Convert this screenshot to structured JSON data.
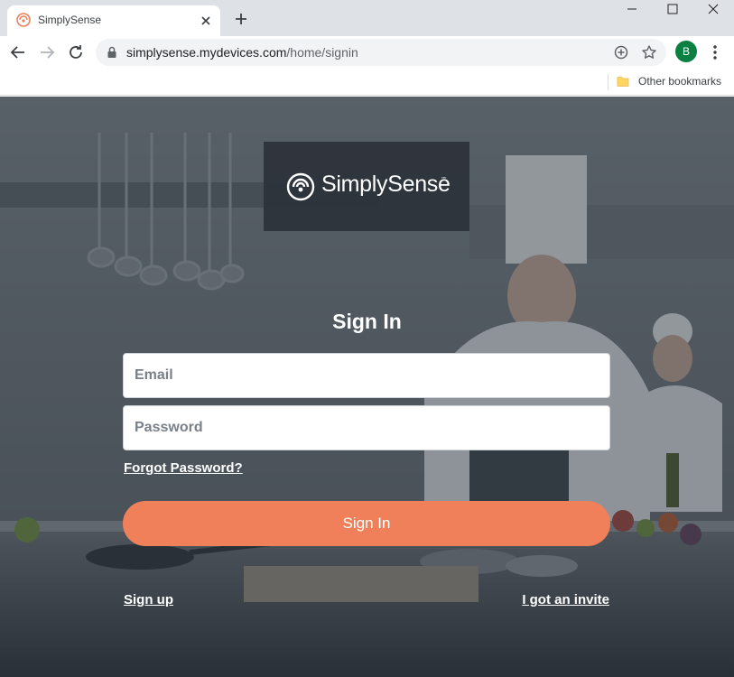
{
  "browser": {
    "tab_title": "SimplySense",
    "url_host": "simplysense.mydevices.com",
    "url_path": "/home/signin",
    "profile_initial": "B",
    "bookmark_folder": "Other bookmarks",
    "colors": {
      "tabstrip": "#dee1e6",
      "omnibox": "#f1f3f4",
      "avatar": "#0b8043"
    },
    "icons": [
      "simplysense-favicon",
      "close-icon",
      "new-tab-icon",
      "minimize-icon",
      "maximize-icon",
      "window-close-icon",
      "back-icon",
      "forward-icon",
      "reload-icon",
      "lock-icon",
      "zoom-icon",
      "star-icon",
      "more-vert-icon",
      "folder-icon"
    ]
  },
  "page": {
    "logo_text": "SimplySense",
    "logo_tm": "™",
    "title": "Sign In",
    "email_placeholder": "Email",
    "password_placeholder": "Password",
    "forgot_label": "Forgot Password?",
    "signin_button": "Sign In",
    "signup_label": "Sign up",
    "invite_label": "I got an invite",
    "colors": {
      "accent": "#f0805a",
      "logo_bg": "#2d3239"
    }
  }
}
